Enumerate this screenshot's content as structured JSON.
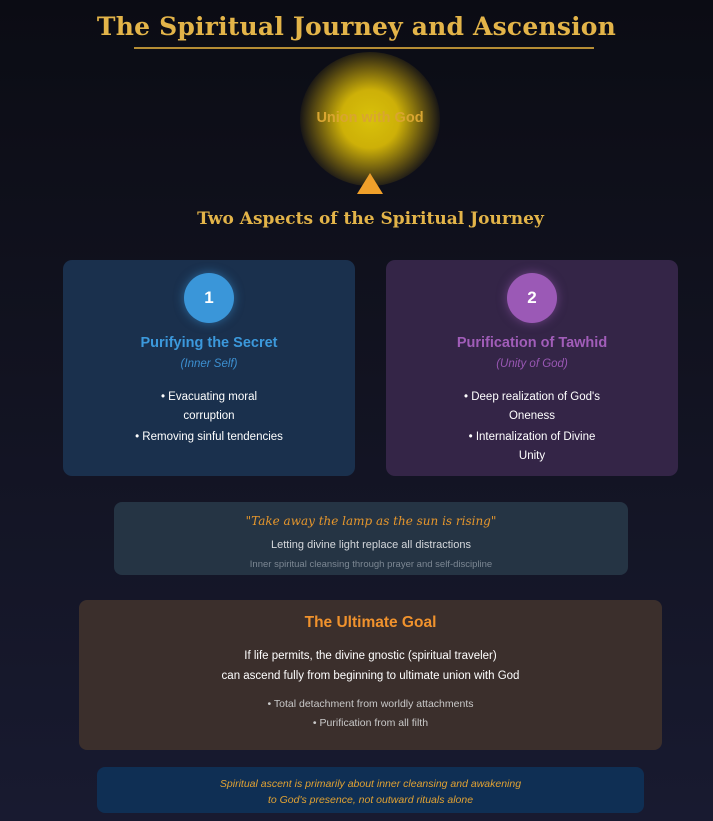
{
  "title": "The Spiritual Journey and Ascension",
  "summit": {
    "label": "Union with God",
    "arrow_icon": "up-triangle-icon",
    "arrow_color": "#f0a02a"
  },
  "section_title": "Two Aspects of the Spiritual Journey",
  "aspects": [
    {
      "number": "1",
      "title": "Purifying the Secret",
      "subtitle": "(Inner Self)",
      "bullets": [
        "• Evacuating moral corruption",
        "• Removing sinful tendencies"
      ],
      "accent": "#3a96d9"
    },
    {
      "number": "2",
      "title": "Purification of Tawhid",
      "subtitle": "(Unity of God)",
      "bullets": [
        "• Deep realization of God's Oneness",
        "• Internalization of Divine Unity"
      ],
      "accent": "#9b59b6"
    }
  ],
  "quote": {
    "text": "\"Take away the lamp as the sun is rising\"",
    "line": "Letting divine light replace all distractions",
    "small": "Inner spiritual cleansing through prayer and self-discipline"
  },
  "goal": {
    "title": "The Ultimate Goal",
    "text_1": "If life permits, the divine gnostic (spiritual traveler)",
    "text_2": "can ascend fully from beginning to ultimate union with God",
    "bullets": [
      "• Total detachment from worldly attachments",
      "• Purification from all filth"
    ]
  },
  "note": {
    "line_1": "Spiritual ascent is primarily about inner cleansing and awakening",
    "line_2": "to God's presence, not outward rituals alone"
  }
}
